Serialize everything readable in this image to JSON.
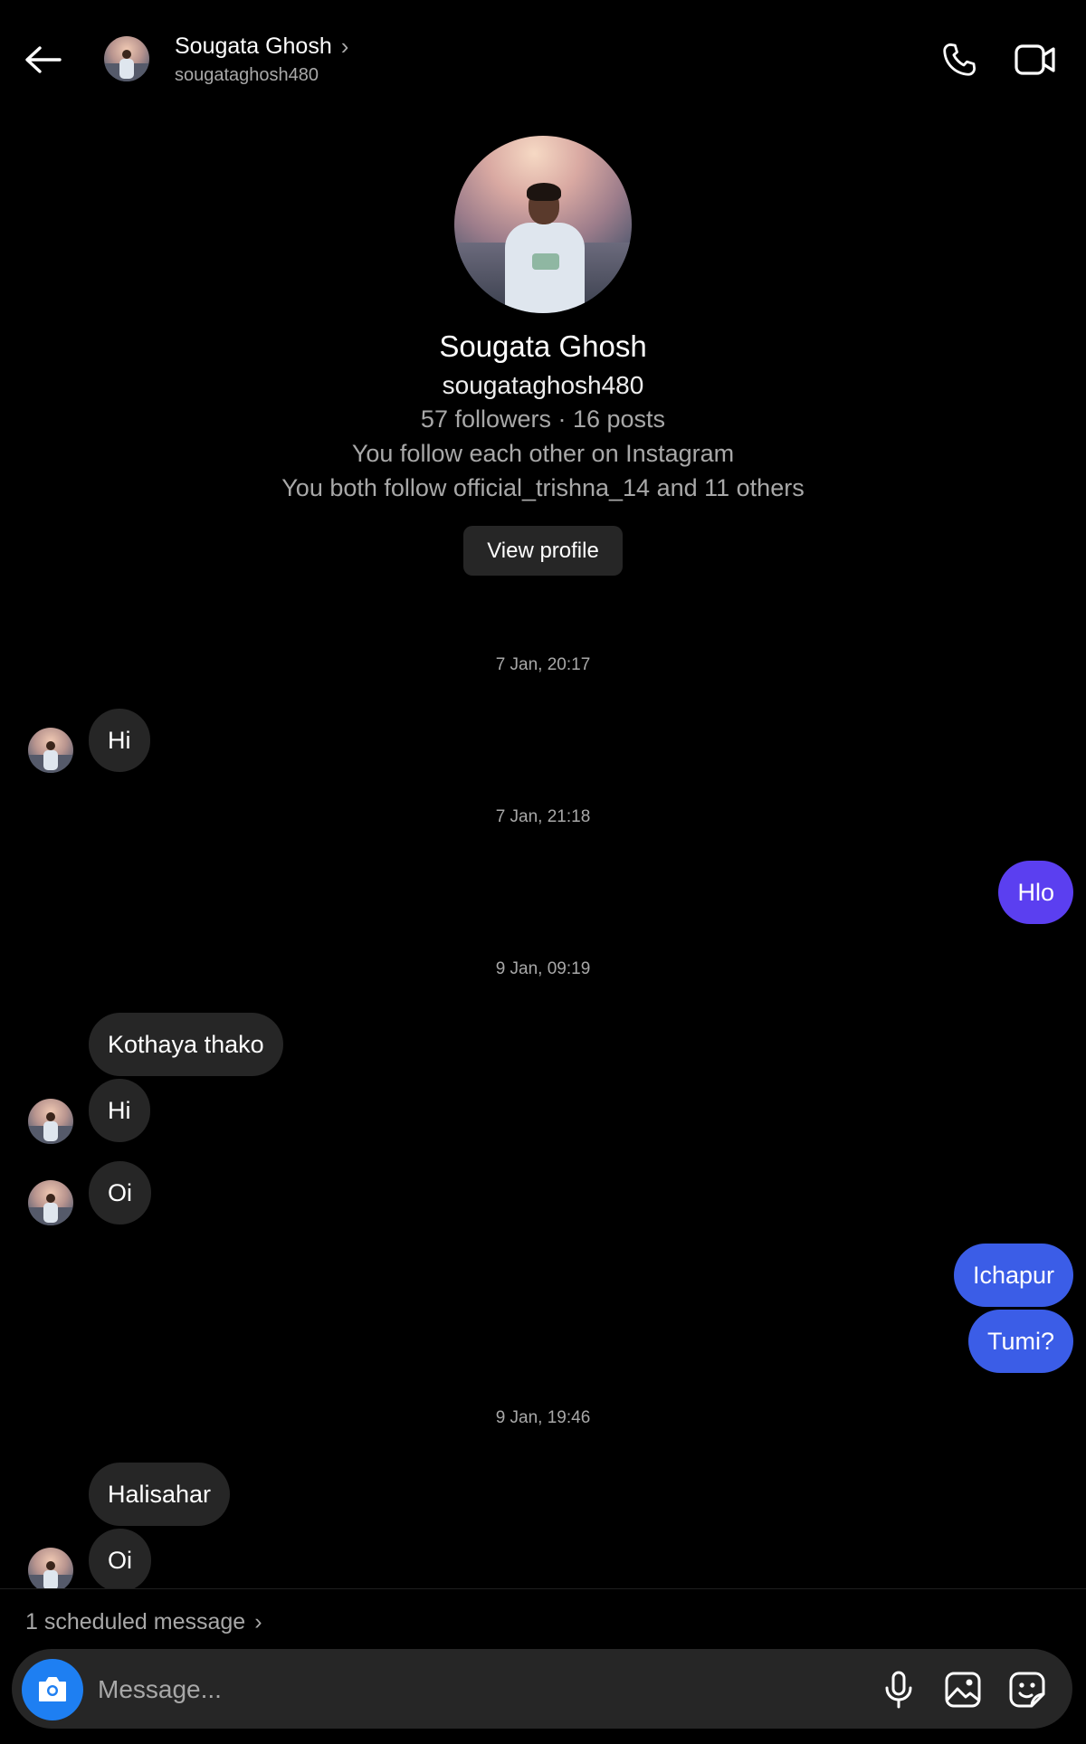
{
  "header": {
    "name": "Sougata Ghosh",
    "username": "sougataghosh480",
    "chevron": "›",
    "icons": [
      "back-arrow-icon",
      "avatar",
      "chevron-right-icon",
      "phone-icon",
      "video-camera-icon"
    ]
  },
  "profile": {
    "name": "Sougata Ghosh",
    "username": "sougataghosh480",
    "stats": "57 followers · 16 posts",
    "mutual_follow": "You follow each other on Instagram",
    "mutual_friends": "You both follow official_trishna_14 and 11 others",
    "view_profile_label": "View profile"
  },
  "timestamps": [
    "7 Jan, 20:17",
    "7 Jan, 21:18",
    "9 Jan, 09:19",
    "9 Jan, 19:46"
  ],
  "messages": [
    {
      "text": "Hi",
      "from": "them"
    },
    {
      "text": "Hlo",
      "from": "me"
    },
    {
      "text": "Kothaya thako",
      "from": "them"
    },
    {
      "text": "Hi",
      "from": "them"
    },
    {
      "text": "Oi",
      "from": "them"
    },
    {
      "text": "Ichapur",
      "from": "me"
    },
    {
      "text": "Tumi?",
      "from": "me"
    },
    {
      "text": "Halisahar",
      "from": "them"
    },
    {
      "text": "Oi",
      "from": "them"
    }
  ],
  "footer": {
    "scheduled": "1 scheduled message",
    "scheduled_chevron": "›",
    "placeholder": "Message...",
    "icons": [
      "camera-icon",
      "microphone-icon",
      "gallery-icon",
      "sticker-icon"
    ]
  },
  "colors": {
    "background": "#000000",
    "incoming_bubble": "#262626",
    "outgoing_bubble_purple": "#5b3ff0",
    "outgoing_bubble_blue": "#3b5de7",
    "camera_button": "#1e7ff2",
    "secondary_text": "#a8a8a8"
  }
}
